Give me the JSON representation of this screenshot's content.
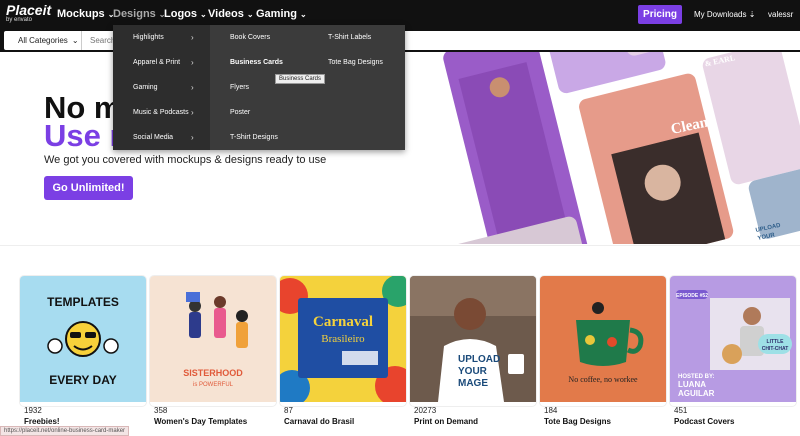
{
  "logo": {
    "brand": "Placeit",
    "by": "by envato"
  },
  "nav": [
    {
      "label": "Mockups"
    },
    {
      "label": "Designs"
    },
    {
      "label": "Logos"
    },
    {
      "label": "Videos"
    },
    {
      "label": "Gaming"
    }
  ],
  "header": {
    "pricing": "Pricing",
    "downloads": "My Downloads ⇣",
    "user": "valessr"
  },
  "search": {
    "category": "All Categories",
    "placeholder": "Search"
  },
  "dropdown": {
    "categories": [
      "Highlights",
      "Apparel & Print",
      "Gaming",
      "Music & Podcasts",
      "Social Media"
    ],
    "col2": [
      "Book Covers",
      "Business Cards",
      "Flyers",
      "Poster",
      "T-Shirt Designs"
    ],
    "col3": [
      "T-Shirt Labels",
      "Tote Bag Designs"
    ],
    "tooltip": "Business Cards"
  },
  "hero": {
    "line1": "No mo",
    "line2": "Use n",
    "subtitle": "We got you covered with mockups & designs ready to use",
    "cta": "Go Unlimited!"
  },
  "cards": [
    {
      "count": "1932",
      "label": "Freebies!",
      "art": [
        "TEMPLATES",
        "EVERY DAY"
      ]
    },
    {
      "count": "358",
      "label": "Women's Day Templates",
      "art": [
        "SISTERHOOD",
        "is POWERFUL"
      ]
    },
    {
      "count": "87",
      "label": "Carnaval do Brasil",
      "art": [
        "Carnaval",
        "Brasileiro"
      ]
    },
    {
      "count": "20273",
      "label": "Print on Demand",
      "art": [
        "UPLOAD",
        "YOUR",
        "MAGE"
      ]
    },
    {
      "count": "184",
      "label": "Tote Bag Designs",
      "art": [
        "No coffee, no workee"
      ]
    },
    {
      "count": "451",
      "label": "Podcast Covers",
      "art": [
        "EPISODE #52",
        "LITTLE",
        "CHIT-CHAT",
        "HOSTED BY:",
        "LUANA",
        "AGUILAR"
      ]
    }
  ],
  "hero_art_text": [
    "Clean.",
    "Y & EARL",
    "UPLOAD",
    "YOUR"
  ],
  "status_url": "https://placeit.net/online-business-card-maker"
}
